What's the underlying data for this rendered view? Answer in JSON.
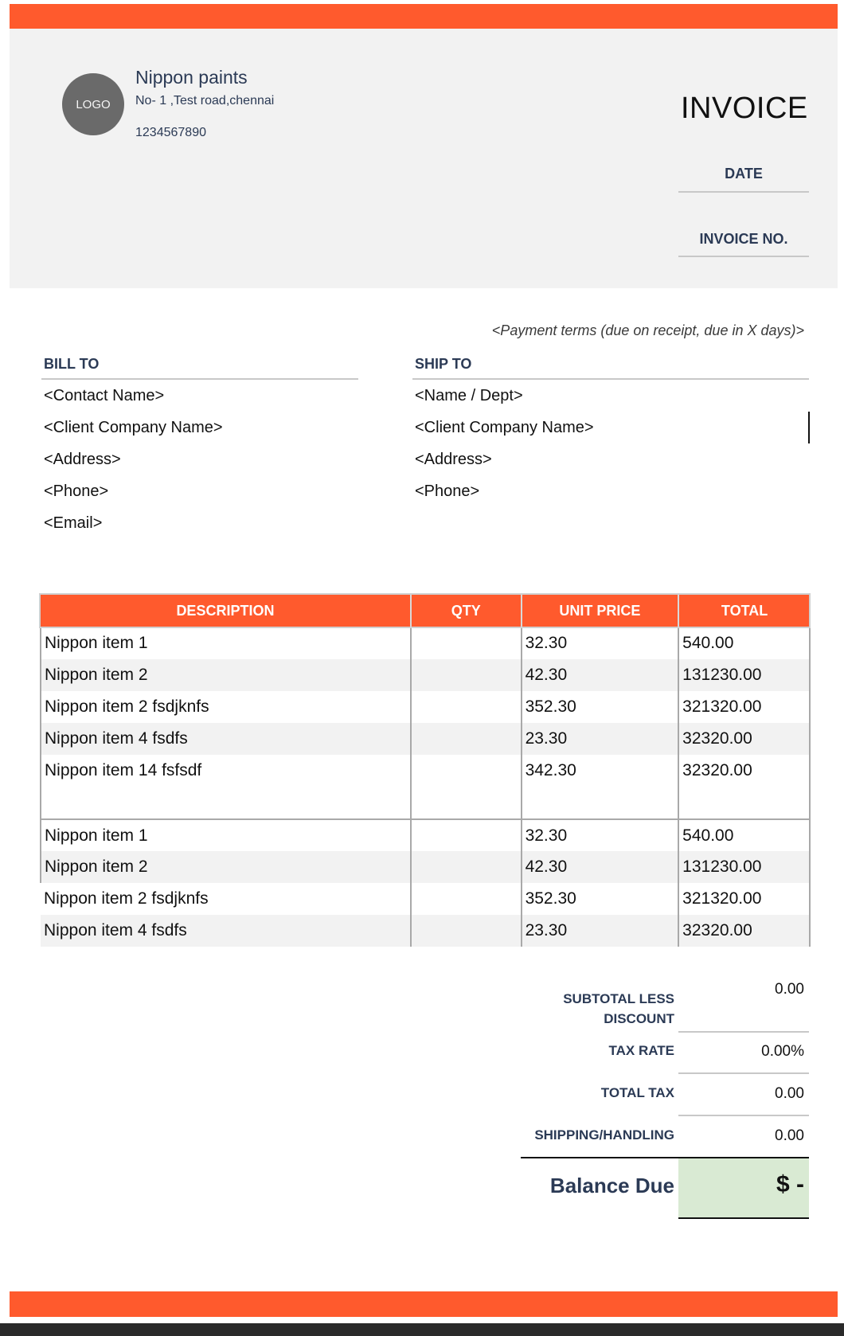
{
  "header": {
    "logo_label": "LOGO",
    "company_name": "Nippon paints",
    "company_address": "No- 1 ,Test road,chennai",
    "company_phone": "1234567890",
    "invoice_title": "INVOICE",
    "date_label": "DATE",
    "invoice_no_label": "INVOICE NO."
  },
  "payment_terms": "<Payment terms (due on receipt, due in X days)>",
  "bill_to": {
    "heading": "BILL TO",
    "lines": [
      "<Contact Name>",
      "<Client Company Name>",
      "<Address>",
      "<Phone>",
      "<Email>"
    ]
  },
  "ship_to": {
    "heading": "SHIP TO",
    "lines": [
      "<Name / Dept>",
      "<Client Company Name>",
      "<Address>",
      "<Phone>"
    ]
  },
  "table": {
    "columns": [
      "DESCRIPTION",
      "QTY",
      "UNIT PRICE",
      "TOTAL"
    ],
    "rows": [
      {
        "description": "Nippon item 1",
        "qty": "",
        "unit_price": "32.30",
        "total": "540.00"
      },
      {
        "description": "Nippon item 2",
        "qty": "",
        "unit_price": "42.30",
        "total": "131230.00"
      },
      {
        "description": "Nippon item 2 fsdjknfs",
        "qty": "",
        "unit_price": "352.30",
        "total": "321320.00"
      },
      {
        "description": "Nippon item 4 fsdfs",
        "qty": "",
        "unit_price": "23.30",
        "total": "32320.00"
      },
      {
        "description": "Nippon item 14 fsfsdf",
        "qty": "",
        "unit_price": "342.30",
        "total": "32320.00"
      },
      {
        "description": "",
        "qty": "",
        "unit_price": "",
        "total": ""
      },
      {
        "description": "Nippon item 1",
        "qty": "",
        "unit_price": "32.30",
        "total": "540.00"
      },
      {
        "description": "Nippon item 2",
        "qty": "",
        "unit_price": "42.30",
        "total": "131230.00"
      },
      {
        "description": "Nippon item 2 fsdjknfs",
        "qty": "",
        "unit_price": "352.30",
        "total": "321320.00"
      },
      {
        "description": "Nippon item 4 fsdfs",
        "qty": "",
        "unit_price": "23.30",
        "total": "32320.00"
      }
    ]
  },
  "totals": {
    "subtotal_label_line1": "SUBTOTAL LESS",
    "subtotal_label_line2": "DISCOUNT",
    "subtotal_value": "0.00",
    "tax_rate_label": "TAX RATE",
    "tax_rate_value": "0.00%",
    "total_tax_label": "TOTAL TAX",
    "total_tax_value": "0.00",
    "shipping_label": "SHIPPING/HANDLING",
    "shipping_value": "0.00",
    "balance_label": "Balance Due",
    "balance_value": "$ -"
  },
  "colors": {
    "accent": "#ff5a2d",
    "heading_text": "#2b3a55",
    "balance_fill": "#d9ead3"
  }
}
